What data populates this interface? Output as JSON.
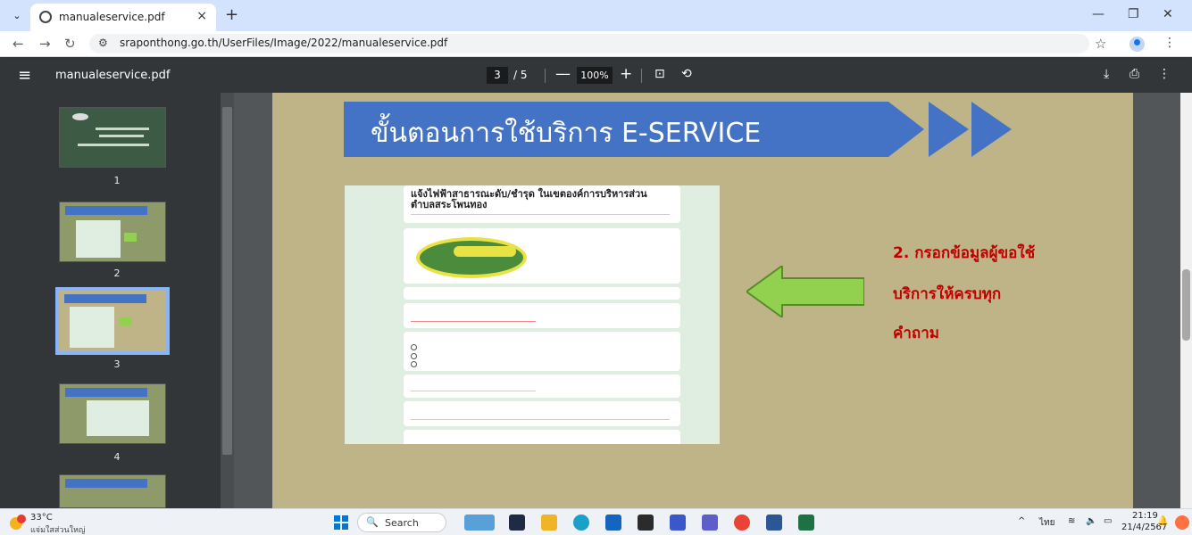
{
  "browser": {
    "tab_title": "manualeservice.pdf",
    "url": "sraponthong.go.th/UserFiles/Image/2022/manualeservice.pdf"
  },
  "pdf_toolbar": {
    "title": "manualeservice.pdf",
    "current_page": "3",
    "total_pages": "/ 5",
    "zoom": "100%"
  },
  "thumbnails": [
    {
      "number": "1"
    },
    {
      "number": "2"
    },
    {
      "number": "3",
      "selected": true
    },
    {
      "number": "4"
    }
  ],
  "slide": {
    "banner_title": "ขั้นตอนการใช้บริการ E-SERVICE",
    "form": {
      "title": "แจ้งไฟฟ้าสาธารณะดับ/ชำรุด ในเขตองค์การบริหารส่วนตำบลสระโพนทอง"
    },
    "note_lines": [
      "2. กรอกข้อมูลผู้ขอใช้",
      "บริการให้ครบทุก",
      "คำถาม"
    ],
    "colors": {
      "banner": "#4472c4",
      "note": "#c00000",
      "arrow": "#92d050",
      "page_bg": "#bfb487"
    }
  },
  "taskbar": {
    "temperature": "33°C",
    "weather_desc": "แจ่มใสส่วนใหญ่",
    "search_label": "Search",
    "language": "ไทย",
    "time": "21:19",
    "date": "21/4/2567"
  }
}
